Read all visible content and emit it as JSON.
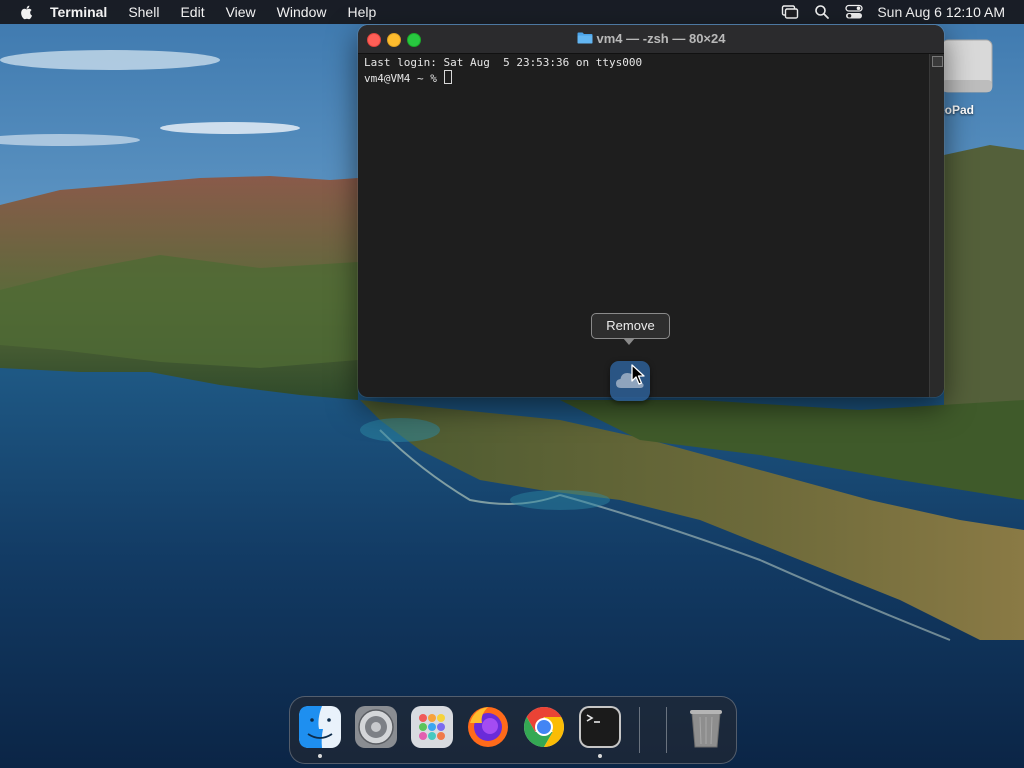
{
  "menubar": {
    "app_name": "Terminal",
    "menus": [
      "Shell",
      "Edit",
      "View",
      "Window",
      "Help"
    ],
    "clock": "Sun Aug 6  12:10 AM"
  },
  "desktop": {
    "drive_label": "eoPad"
  },
  "terminal": {
    "title": "vm4 — -zsh — 80×24",
    "lines": [
      "Last login: Sat Aug  5 23:53:36 on ttys000"
    ],
    "prompt": "vm4@VM4 ~ % "
  },
  "tooltip": {
    "text": "Remove"
  },
  "dock": {
    "items": [
      "finder-icon",
      "system-preferences-icon",
      "launchpad-icon",
      "firefox-icon",
      "chrome-icon",
      "terminal-icon",
      "trash-icon"
    ],
    "running": [
      "finder",
      "terminal"
    ]
  },
  "colors": {
    "close": "#fe5f57",
    "minimize": "#febc2e",
    "zoom": "#28c840",
    "terminal_bg": "#1e1e1e"
  }
}
